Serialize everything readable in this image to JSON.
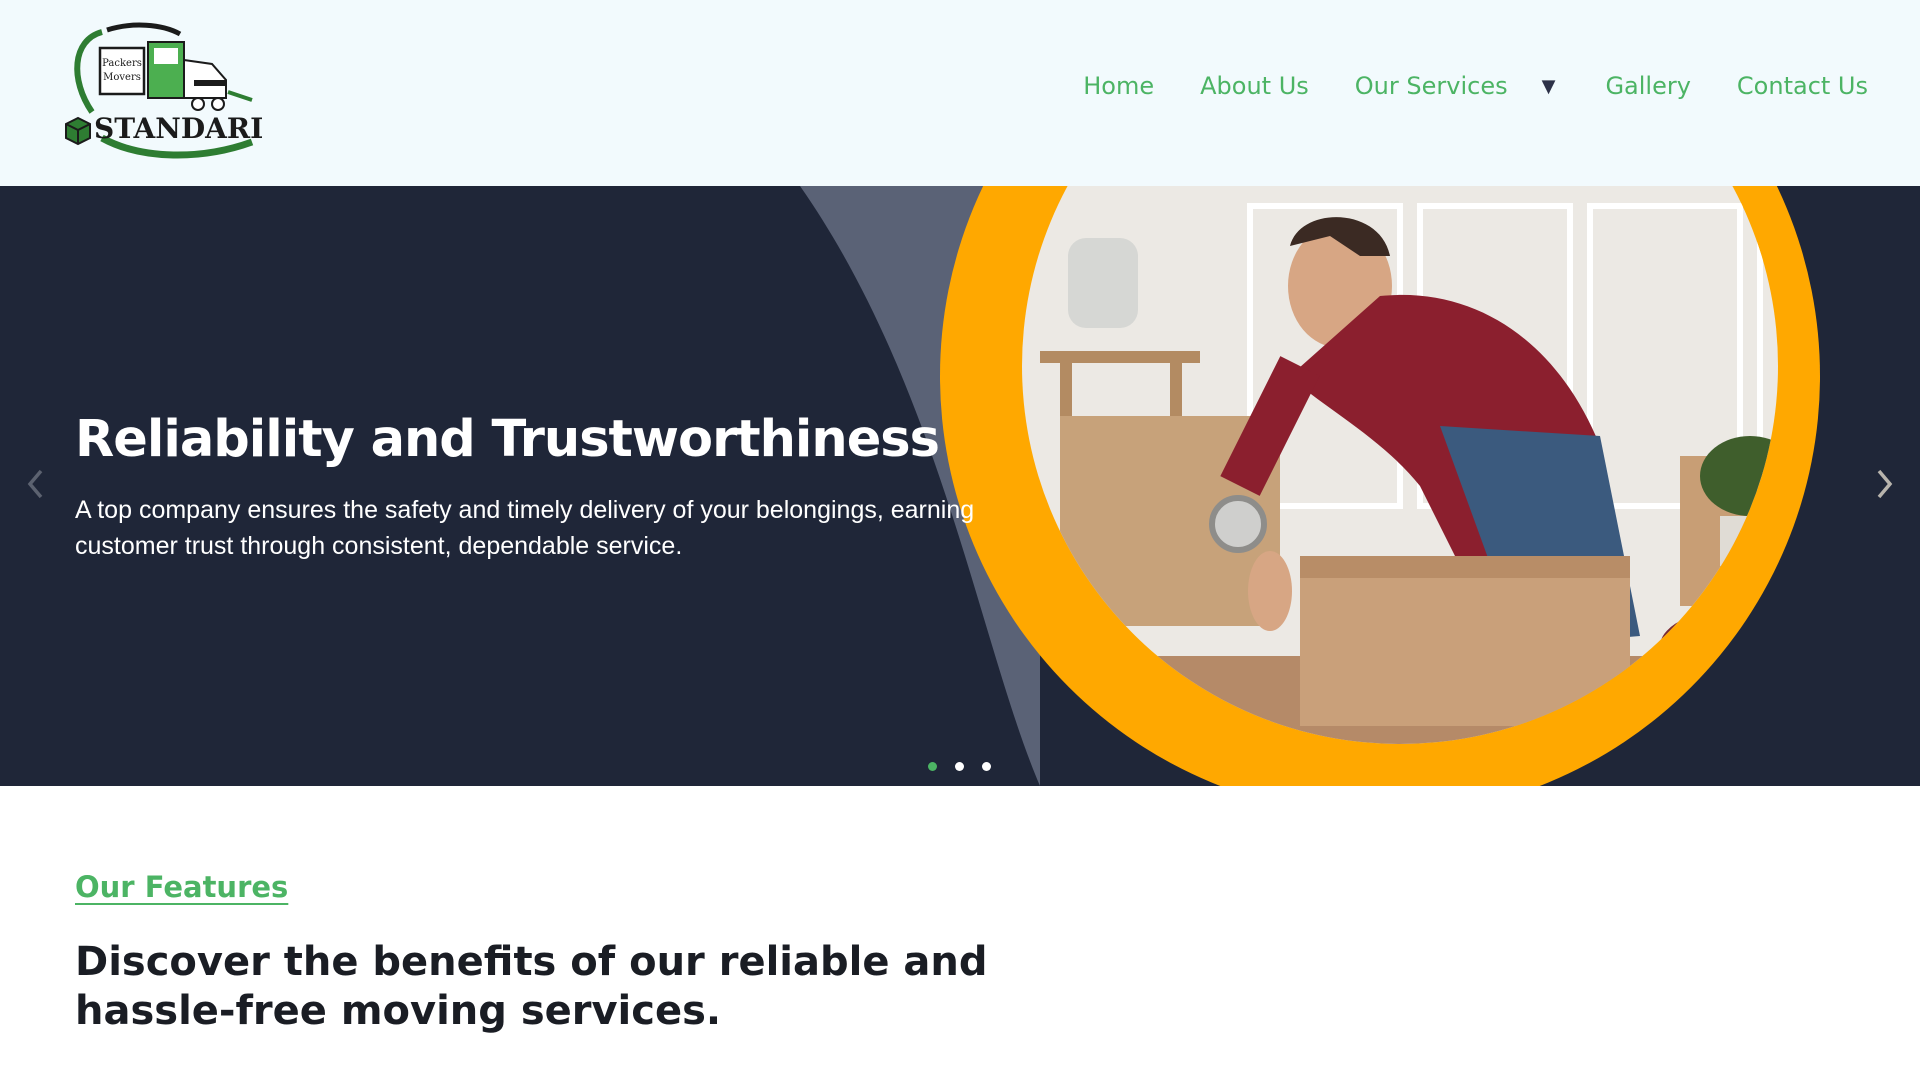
{
  "brand": {
    "logo_top_text": "Packers",
    "logo_bottom_text": "Movers",
    "logo_name": "STANDARD",
    "logo_icon": "truck-icon",
    "logo_color": "#2e7d32"
  },
  "nav": {
    "items": [
      {
        "label": "Home"
      },
      {
        "label": "About Us"
      },
      {
        "label": "Our Services"
      },
      {
        "label": "Gallery"
      },
      {
        "label": "Contact Us"
      }
    ],
    "dropdown_icon": "caret-down-icon",
    "link_color": "#4cb464"
  },
  "hero": {
    "title": "Reliability and Trustworthiness",
    "text": "A top company ensures the safety and timely delivery of your belongings, earning customer trust through consistent, dependable service.",
    "prev_icon": "chevron-left-icon",
    "next_icon": "chevron-right-icon",
    "slides_count": 3,
    "active_slide": 1,
    "background_color": "#1f2638",
    "accent_color": "#ffa800"
  },
  "features": {
    "label": "Our Features",
    "heading": "Discover the benefits of our reliable and hassle-free moving services."
  }
}
